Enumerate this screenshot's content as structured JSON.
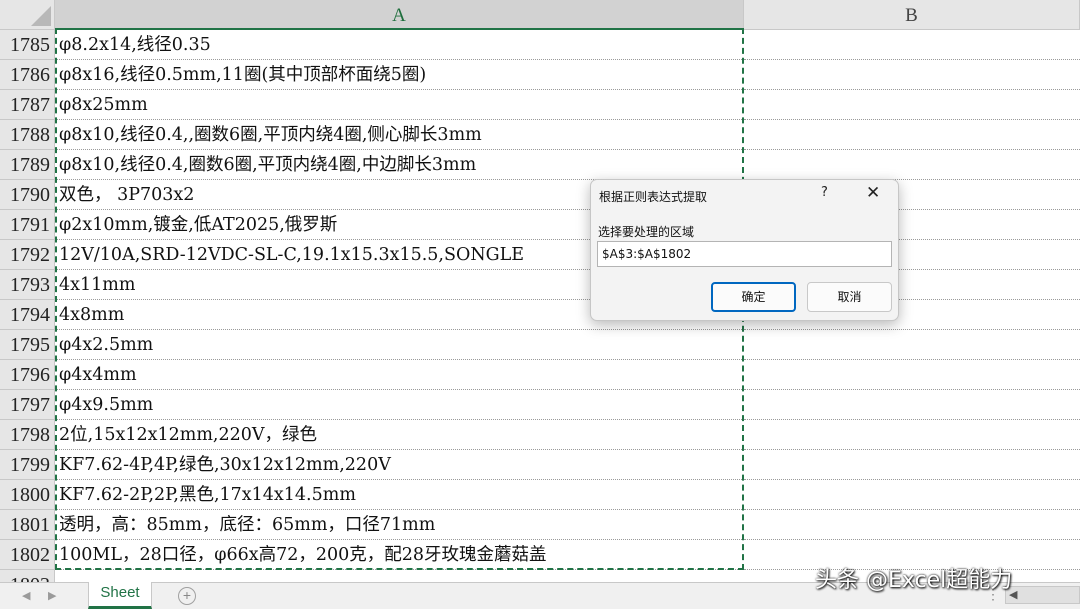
{
  "columns": [
    "A",
    "B"
  ],
  "rows": [
    {
      "num": "1785",
      "a": "φ8.2x14,线径0.35"
    },
    {
      "num": "1786",
      "a": "φ8x16,线径0.5mm,11圈(其中顶部杯面绕5圈)"
    },
    {
      "num": "1787",
      "a": "φ8x25mm"
    },
    {
      "num": "1788",
      "a": "φ8x10,线径0.4,,圈数6圈,平顶内绕4圈,侧心脚长3mm"
    },
    {
      "num": "1789",
      "a": "φ8x10,线径0.4,圈数6圈,平顶内绕4圈,中边脚长3mm"
    },
    {
      "num": "1790",
      "a": "双色， 3P703x2"
    },
    {
      "num": "1791",
      "a": "φ2x10mm,镀金,低AT2025,俄罗斯"
    },
    {
      "num": "1792",
      "a": "12V/10A,SRD-12VDC-SL-C,19.1x15.3x15.5,SONGLE"
    },
    {
      "num": "1793",
      "a": "4x11mm"
    },
    {
      "num": "1794",
      "a": "4x8mm"
    },
    {
      "num": "1795",
      "a": "φ4x2.5mm"
    },
    {
      "num": "1796",
      "a": "φ4x4mm"
    },
    {
      "num": "1797",
      "a": "φ4x9.5mm"
    },
    {
      "num": "1798",
      "a": "2位,15x12x12mm,220V，绿色"
    },
    {
      "num": "1799",
      "a": "KF7.62-4P,4P,绿色,30x12x12mm,220V"
    },
    {
      "num": "1800",
      "a": "KF7.62-2P,2P,黑色,17x14x14.5mm"
    },
    {
      "num": "1801",
      "a": "透明，高：85mm，底径：65mm，口径71mm"
    },
    {
      "num": "1802",
      "a": "100ML，28口径，φ66x高72，200克，配28牙玫瑰金蘑菇盖"
    }
  ],
  "partial_row_num": "1803",
  "sheet_tab": "Sheet",
  "watermark": "头条 @Excel超能力",
  "dialog": {
    "title": "根据正则表达式提取",
    "help": "?",
    "close": "✕",
    "label": "选择要处理的区域",
    "input_value": "$A$3:$A$1802",
    "ok_label": "确定",
    "cancel_label": "取消"
  },
  "colors": {
    "accent": "#217346",
    "dialog_focus": "#0067c0",
    "header_bg": "#e6e6e6"
  }
}
